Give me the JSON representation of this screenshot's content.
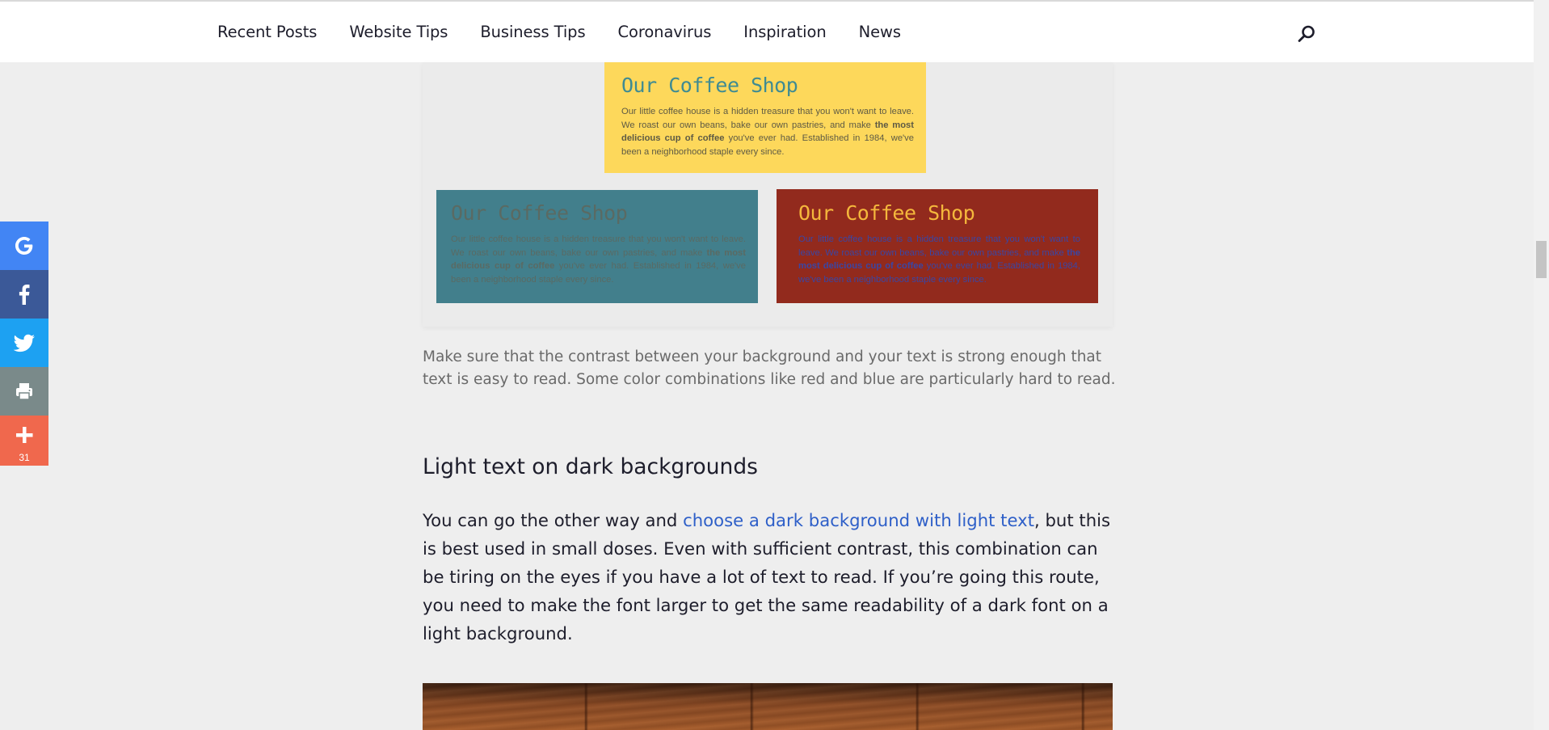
{
  "nav": {
    "items": [
      "Recent Posts",
      "Website Tips",
      "Business Tips",
      "Coronavirus",
      "Inspiration",
      "News"
    ]
  },
  "share": {
    "buttons": [
      {
        "name": "google-share-button",
        "icon": "google-icon",
        "color": "#4285f4"
      },
      {
        "name": "facebook-share-button",
        "icon": "facebook-icon",
        "color": "#3b5998"
      },
      {
        "name": "twitter-share-button",
        "icon": "twitter-icon",
        "color": "#1da1f2"
      },
      {
        "name": "print-button",
        "icon": "printer-icon",
        "color": "#7a8a8a"
      },
      {
        "name": "more-share-button",
        "icon": "plus-icon",
        "color": "#f0684d"
      }
    ],
    "count": "31"
  },
  "swatches": {
    "title": "Our Coffee Shop",
    "body_before": "Our little coffee house is a hidden treasure that you won't want to leave. We roast our own beans, bake our own pastries, and make ",
    "body_bold": "the most delicious cup of coffee",
    "body_after": " you've ever had. Established in 1984, we've been a neighborhood staple every since."
  },
  "article": {
    "caption": "Make sure that the contrast between your background and your text is strong enough that text is easy to read. Some color combinations like red and blue are particularly hard to read.",
    "heading": "Light text on dark backgrounds",
    "para_before": "You can go the other way and ",
    "para_link": "choose a dark background with light text",
    "para_after": ", but this is best used in small doses. Even with sufficient contrast, this combination can be tiring on the eyes if you have a lot of text to read. If you’re going this route, you need to make the font larger to get the same readability of a dark font on a light background."
  },
  "colors": {
    "link": "#2e5fc8",
    "yellow_swatch": "#fdd85b",
    "blue_swatch": "#427f8c",
    "red_swatch": "#922a1d"
  }
}
